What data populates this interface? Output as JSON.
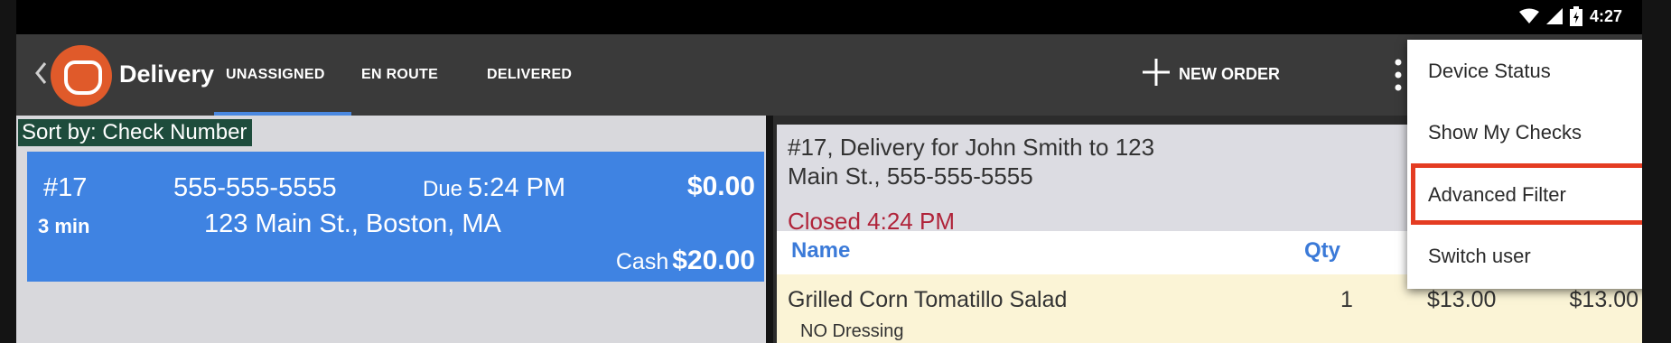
{
  "status_bar": {
    "time": "4:27",
    "icons": [
      "wifi-icon",
      "cell-signal-icon",
      "battery-icon"
    ]
  },
  "app_bar": {
    "title": "Delivery",
    "brand_color": "#e05a2a",
    "tabs": [
      {
        "label": "UNASSIGNED",
        "selected": true
      },
      {
        "label": "EN ROUTE",
        "selected": false
      },
      {
        "label": "DELIVERED",
        "selected": false
      }
    ],
    "new_order_label": "NEW ORDER"
  },
  "order_list": {
    "sort_label": "Sort by: Check Number",
    "orders": [
      {
        "number": "#17",
        "phone": "555-555-5555",
        "due_label": "Due",
        "due_time": "5:24 PM",
        "amount": "$0.00",
        "elapsed": "3 min",
        "address": "123 Main St., Boston, MA",
        "payment_label": "Cash",
        "payment_amount": "$20.00",
        "card_color": "#3f83e2"
      }
    ]
  },
  "order_detail": {
    "title_line1": "#17, Delivery for John Smith to 123",
    "title_line2": "Main St., 555-555-5555",
    "status": "Closed 4:24 PM",
    "status_color": "#b0243a",
    "columns": [
      "Name",
      "Qty"
    ],
    "items": [
      {
        "name": "Grilled Corn Tomatillo Salad",
        "modifier": "NO Dressing",
        "qty": "1",
        "price": "$13.00",
        "total": "$13.00"
      }
    ]
  },
  "overflow_menu": {
    "items": [
      {
        "label": "Device Status",
        "highlighted": false
      },
      {
        "label": "Show My Checks",
        "highlighted": false
      },
      {
        "label": "Advanced Filter",
        "highlighted": true
      },
      {
        "label": "Switch user",
        "highlighted": false
      }
    ],
    "highlight_color": "#e43c22"
  }
}
